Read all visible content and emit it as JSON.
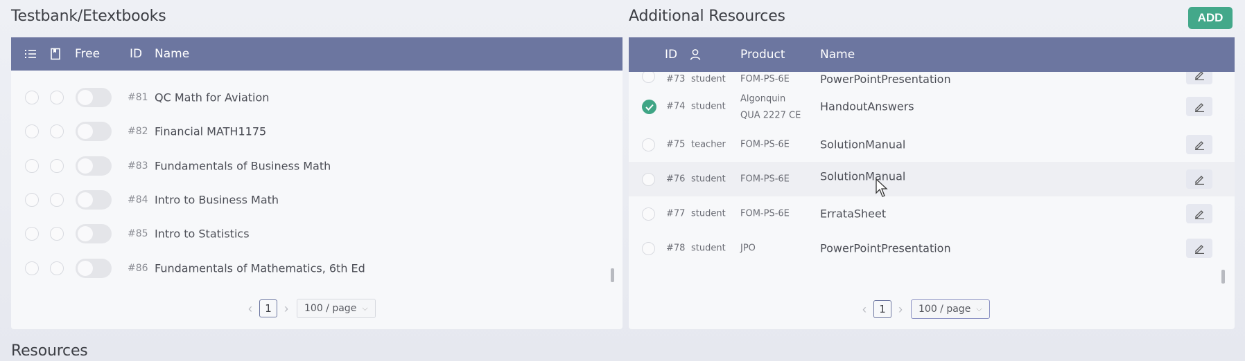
{
  "testbank": {
    "title": "Testbank/Etextbooks",
    "columns": {
      "free": "Free",
      "id": "ID",
      "name": "Name"
    },
    "icons": [
      "list-icon",
      "bookmark-icon"
    ],
    "rows": [
      {
        "id": "#81",
        "name": "QC Math for Aviation"
      },
      {
        "id": "#82",
        "name": "Financial MATH1175"
      },
      {
        "id": "#83",
        "name": "Fundamentals of Business Math"
      },
      {
        "id": "#84",
        "name": "Intro to Business Math"
      },
      {
        "id": "#85",
        "name": "Intro to Statistics"
      },
      {
        "id": "#86",
        "name": "Fundamentals of Mathematics, 6th Ed"
      }
    ],
    "pagination": {
      "page": "1",
      "page_size": "100 / page"
    }
  },
  "additional": {
    "title": "Additional Resources",
    "add_label": "ADD",
    "columns": {
      "id": "ID",
      "product": "Product",
      "name": "Name"
    },
    "rows": [
      {
        "id": "#73",
        "role": "student",
        "product": "FOM-PS-6E",
        "product2": "",
        "name": "PowerPointPresentation",
        "checked": false
      },
      {
        "id": "#74",
        "role": "student",
        "product": "Algonquin",
        "product2": "QUA 2227 CE",
        "name": "HandoutAnswers",
        "checked": true
      },
      {
        "id": "#75",
        "role": "teacher",
        "product": "FOM-PS-6E",
        "product2": "",
        "name": "SolutionManual",
        "checked": false
      },
      {
        "id": "#76",
        "role": "student",
        "product": "FOM-PS-6E",
        "product2": "",
        "name": "SolutionManual",
        "checked": false
      },
      {
        "id": "#77",
        "role": "student",
        "product": "FOM-PS-6E",
        "product2": "",
        "name": "ErrataSheet",
        "checked": false
      },
      {
        "id": "#78",
        "role": "student",
        "product": "JPO",
        "product2": "",
        "name": "PowerPointPresentation",
        "checked": false
      }
    ],
    "pagination": {
      "page": "1",
      "page_size": "100 / page"
    }
  },
  "resources": {
    "title": "Resources"
  },
  "colors": {
    "header_bg": "#6c76a0",
    "accent_green": "#43a88a",
    "panel_bg": "#f7f8fa"
  }
}
